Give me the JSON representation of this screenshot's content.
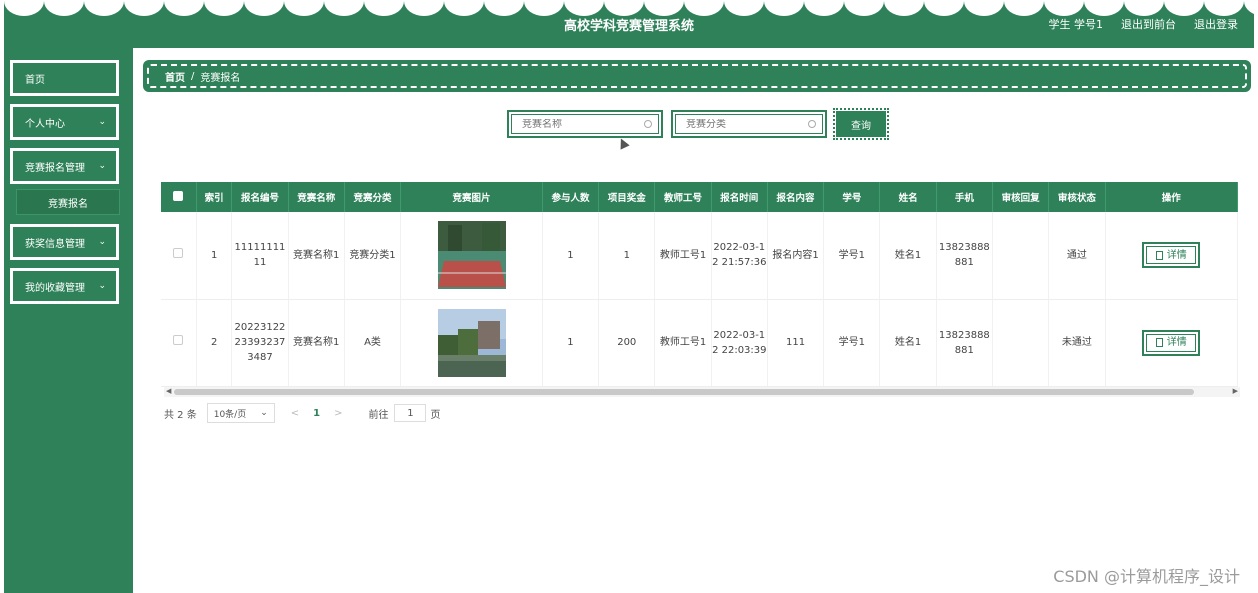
{
  "header": {
    "title": "高校学科竞赛管理系统",
    "user_label": "学生 学号1",
    "back_front": "退出到前台",
    "logout": "退出登录"
  },
  "sidebar": {
    "items": [
      {
        "label": "首页"
      },
      {
        "label": "个人中心"
      },
      {
        "label": "竞赛报名管理"
      },
      {
        "label": "获奖信息管理"
      },
      {
        "label": "我的收藏管理"
      }
    ],
    "sub_item": "竞赛报名"
  },
  "breadcrumb": {
    "home": "首页",
    "separator": "/",
    "current": "竞赛报名"
  },
  "search": {
    "name_placeholder": "竞赛名称",
    "category_placeholder": "竞赛分类",
    "query_button": "查询"
  },
  "table": {
    "headers": [
      "索引",
      "报名编号",
      "竞赛名称",
      "竞赛分类",
      "竞赛图片",
      "参与人数",
      "项目奖金",
      "教师工号",
      "报名时间",
      "报名内容",
      "学号",
      "姓名",
      "手机",
      "审核回复",
      "审核状态",
      "操作"
    ],
    "rows": [
      {
        "index": "1",
        "reg_no": "1111111111",
        "comp_name": "竞赛名称1",
        "category": "竞赛分类1",
        "participants": "1",
        "bonus": "1",
        "teacher_no": "教师工号1",
        "reg_time": "2022-03-12 21:57:36",
        "content": "报名内容1",
        "student_no": "学号1",
        "name": "姓名1",
        "phone": "13823888881",
        "reply": "",
        "status": "通过",
        "action": "详情"
      },
      {
        "index": "2",
        "reg_no": "20223122233932373487",
        "comp_name": "竞赛名称1",
        "category": "A类",
        "participants": "1",
        "bonus": "200",
        "teacher_no": "教师工号1",
        "reg_time": "2022-03-12 22:03:39",
        "content": "111",
        "student_no": "学号1",
        "name": "姓名1",
        "phone": "13823888881",
        "reply": "",
        "status": "未通过",
        "action": "详情"
      }
    ]
  },
  "pagination": {
    "total": "共 2 条",
    "page_size": "10条/页",
    "prev": "<",
    "current_page": "1",
    "next": ">",
    "goto_label": "前往",
    "goto_value": "1",
    "page_word": "页"
  },
  "watermark": "CSDN @计算机程序_设计",
  "colors": {
    "primary": "#2e8159"
  }
}
